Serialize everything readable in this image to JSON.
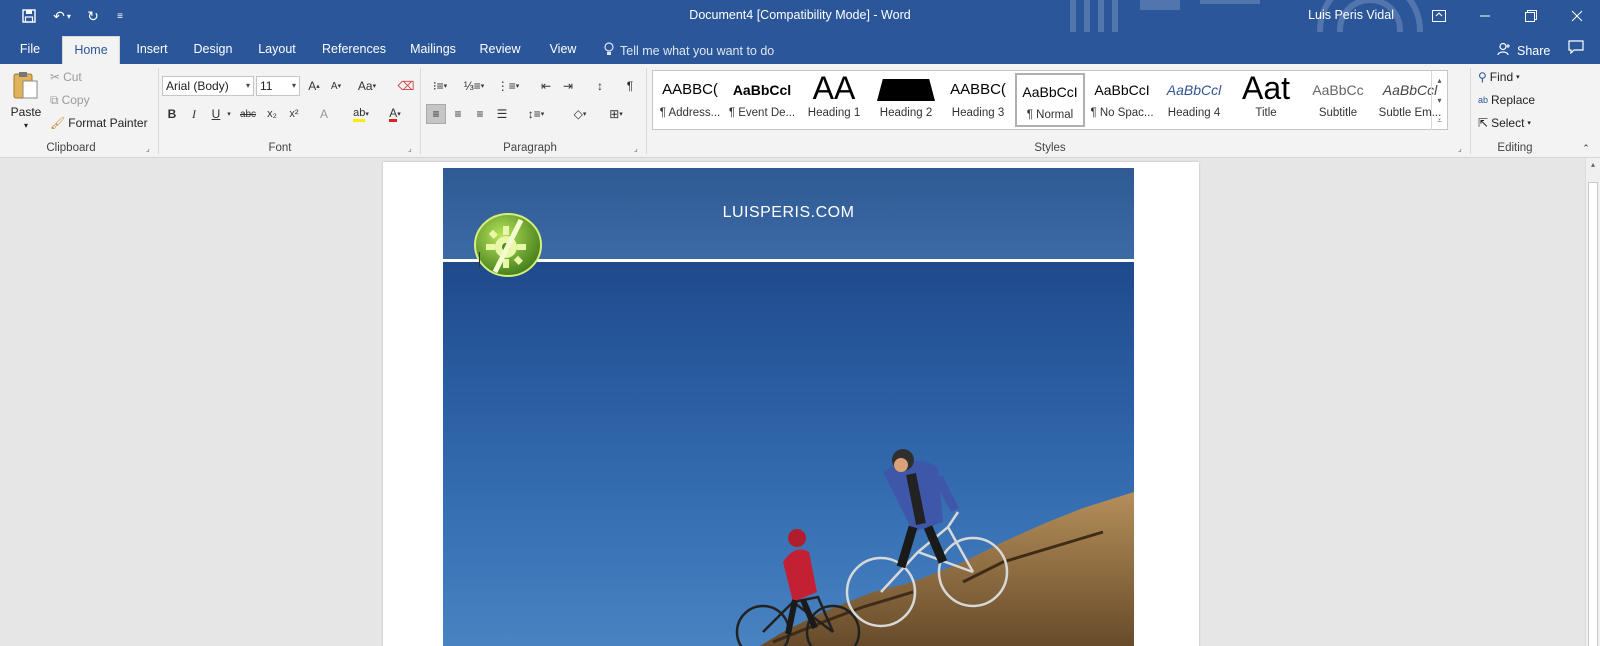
{
  "window": {
    "title": "Document4 [Compatibility Mode] - Word",
    "user": "Luis Peris Vidal",
    "colors": {
      "accent": "#2b579a",
      "ribbon_bg": "#f3f3f3"
    }
  },
  "qat": {
    "save_icon": "save-icon",
    "undo_icon": "undo-icon",
    "redo_icon": "redo-icon",
    "customize_icon": "customize-qat-icon"
  },
  "tabs": [
    {
      "label": "File"
    },
    {
      "label": "Home"
    },
    {
      "label": "Insert"
    },
    {
      "label": "Design"
    },
    {
      "label": "Layout"
    },
    {
      "label": "References"
    },
    {
      "label": "Mailings"
    },
    {
      "label": "Review"
    },
    {
      "label": "View"
    }
  ],
  "active_tab": "Home",
  "tellme": "Tell me what you want to do",
  "share": "Share",
  "clipboard": {
    "paste": "Paste",
    "cut": "Cut",
    "copy": "Copy",
    "format_painter": "Format Painter",
    "label": "Clipboard"
  },
  "font": {
    "name": "Arial (Body)",
    "size": "11",
    "change_case": "Aa",
    "bold": "B",
    "italic": "I",
    "underline": "U",
    "strike": "abc",
    "subscript": "x₂",
    "superscript": "x²",
    "label": "Font"
  },
  "paragraph": {
    "label": "Paragraph",
    "pilcrow": "¶"
  },
  "styles": {
    "label": "Styles",
    "items": [
      {
        "preview": "AABBC(",
        "name": "¶ Address..."
      },
      {
        "preview": "AaBbCcl",
        "name": "¶ Event De..."
      },
      {
        "preview": "AA",
        "name": "Heading 1"
      },
      {
        "preview": "A",
        "name": "Heading 2"
      },
      {
        "preview": "AABBC(",
        "name": "Heading 3"
      },
      {
        "preview": "AaBbCcI",
        "name": "¶ Normal"
      },
      {
        "preview": "AaBbCcI",
        "name": "¶ No Spac..."
      },
      {
        "preview": "AaBbCcl",
        "name": "Heading 4"
      },
      {
        "preview": "Aat",
        "name": "Title"
      },
      {
        "preview": "AaBbCc",
        "name": "Subtitle"
      },
      {
        "preview": "AaBbCcl",
        "name": "Subtle Em..."
      }
    ],
    "selected": "¶ Normal"
  },
  "editing": {
    "find": "Find",
    "replace": "Replace",
    "select": "Select",
    "label": "Editing"
  },
  "document": {
    "header_text": "LUISPERIS.COM"
  }
}
